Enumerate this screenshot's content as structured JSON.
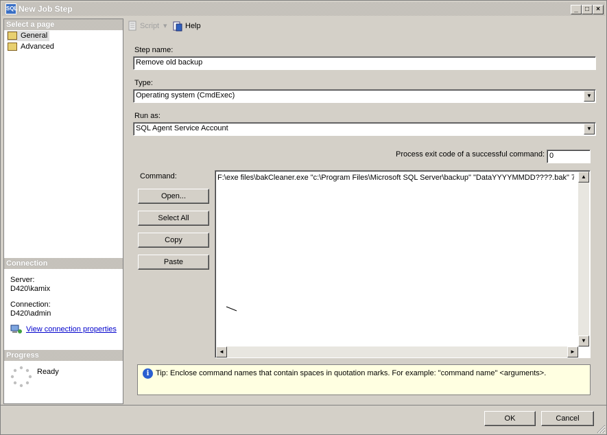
{
  "window": {
    "title": "New Job Step",
    "app_icon": "SQL",
    "minimize": "_",
    "maximize": "□",
    "close": "×"
  },
  "left_pane": {
    "select_page_header": "Select a page",
    "pages": [
      {
        "label": "General",
        "icon": "page-icon",
        "selected": true
      },
      {
        "label": "Advanced",
        "icon": "page-icon",
        "selected": false
      }
    ],
    "connection_header": "Connection",
    "server_label": "Server:",
    "server_value": "D420\\kamix",
    "connection_label": "Connection:",
    "connection_value": "D420\\admin",
    "view_connection_link": "View connection properties",
    "progress_header": "Progress",
    "progress_status": "Ready"
  },
  "toolbar": {
    "script_label": "Script",
    "script_dropdown": "▾",
    "help_label": "Help"
  },
  "form": {
    "step_name_label": "Step name:",
    "step_name_value": "Remove old backup",
    "type_label": "Type:",
    "type_value": "Operating system (CmdExec)",
    "run_as_label": "Run as:",
    "run_as_value": "SQL Agent Service Account",
    "exit_code_label": "Process exit code of a successful command:",
    "exit_code_value": "0",
    "command_label": "Command:",
    "command_text": "F:\\exe files\\bakCleaner.exe \"c:\\Program Files\\Microsoft SQL Server\\backup\" \"DataYYYYMMDD????.bak\" 7",
    "buttons": {
      "open": "Open...",
      "select_all": "Select All",
      "copy": "Copy",
      "paste": "Paste"
    },
    "combo_arrow": "▼",
    "scroll_up": "▲",
    "scroll_down": "▼",
    "scroll_left": "◄",
    "scroll_right": "►"
  },
  "tip": {
    "icon_glyph": "i",
    "text": "Tip: Enclose command names that contain spaces in quotation marks. For example: \"command name\" <arguments>."
  },
  "footer": {
    "ok": "OK",
    "cancel": "Cancel"
  }
}
